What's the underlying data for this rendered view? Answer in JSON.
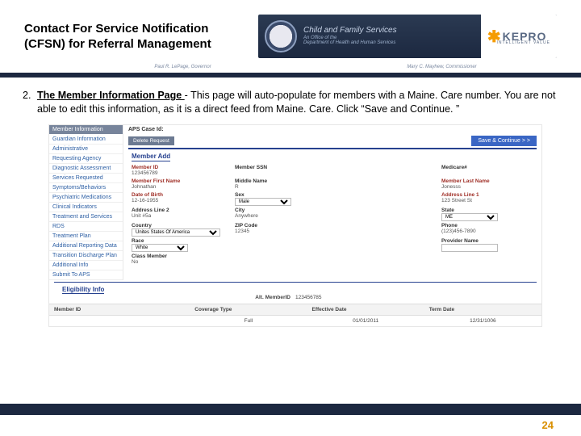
{
  "header": {
    "title_line1": "Contact For Service Notification",
    "title_line2": "(CFSN) for Referral Management",
    "agency_name": "Child and Family Services",
    "agency_sub1": "An Office of the",
    "agency_sub2": "Department of Health and Human Services",
    "gov_left": "Paul R. LePage, Governor",
    "gov_right": "Mary C. Mayhew, Commissioner",
    "kepro_name": "KEPRO",
    "kepro_tag": "INTELLIGENT VALUE"
  },
  "step": {
    "num": "2.",
    "heading": "The Member Information Page ",
    "rest": "- This page will auto-populate for members with a Maine. Care number. You are not able to edit this information, as it is a direct feed from Maine. Care. Click “Save and Continue. ”"
  },
  "ui": {
    "side_header": "Member Information",
    "side_items": [
      "Guardian Information",
      "Administrative",
      "Requesting Agency",
      "Diagnostic Assessment",
      "Services Requested",
      "Symptoms/Behaviors",
      "Psychiatric Medications",
      "Clinical Indicators",
      "Treatment and Services",
      "RDS",
      "Treatment Plan",
      "Additional Reporting Data",
      "Transition Discharge Plan",
      "Additional Info",
      "Submit To APS"
    ],
    "aps_label": "APS Case Id:",
    "delete_btn": "Delete Request",
    "save_btn": "Save & Continue > >",
    "section_member_add": "Member Add",
    "section_elig": "Eligibility Info",
    "fields": {
      "member_id": {
        "label": "Member ID",
        "value": "123456789"
      },
      "ssn": {
        "label": "Member SSN",
        "value": ""
      },
      "medicare": {
        "label": "Medicare#",
        "value": ""
      },
      "first": {
        "label": "Member First Name",
        "value": "Johnathan"
      },
      "middle": {
        "label": "Middle Name",
        "value": "R"
      },
      "last": {
        "label": "Member Last Name",
        "value": "Jonesss"
      },
      "dob": {
        "label": "Date of Birth",
        "value": "12-16-1955"
      },
      "sex": {
        "label": "Sex",
        "value": "Male"
      },
      "addr1": {
        "label": "Address Line 1",
        "value": "123 Street St"
      },
      "addr2": {
        "label": "Address Line 2",
        "value": "Unit #5a"
      },
      "city": {
        "label": "City",
        "value": "Anywhere"
      },
      "state": {
        "label": "State",
        "value": "ME"
      },
      "country": {
        "label": "Country",
        "value": "Unites States Of America"
      },
      "zip": {
        "label": "ZIP Code",
        "value": "12345"
      },
      "phone": {
        "label": "Phone",
        "value": "(123)456-7890"
      },
      "race": {
        "label": "Race",
        "value": "White"
      },
      "provider": {
        "label": "Provider Name",
        "value": ""
      },
      "class": {
        "label": "Class Member",
        "value": "No"
      }
    },
    "alt_label": "Alt. MemberID",
    "alt_value": "123456785",
    "table": {
      "h1": "Member ID",
      "h2": "Coverage Type",
      "h3": "Effective Date",
      "h4": "Term Date",
      "c1": "",
      "c2": "Full",
      "c3": "01/01/2011",
      "c4": "12/31/1006"
    }
  },
  "page_number": "24"
}
